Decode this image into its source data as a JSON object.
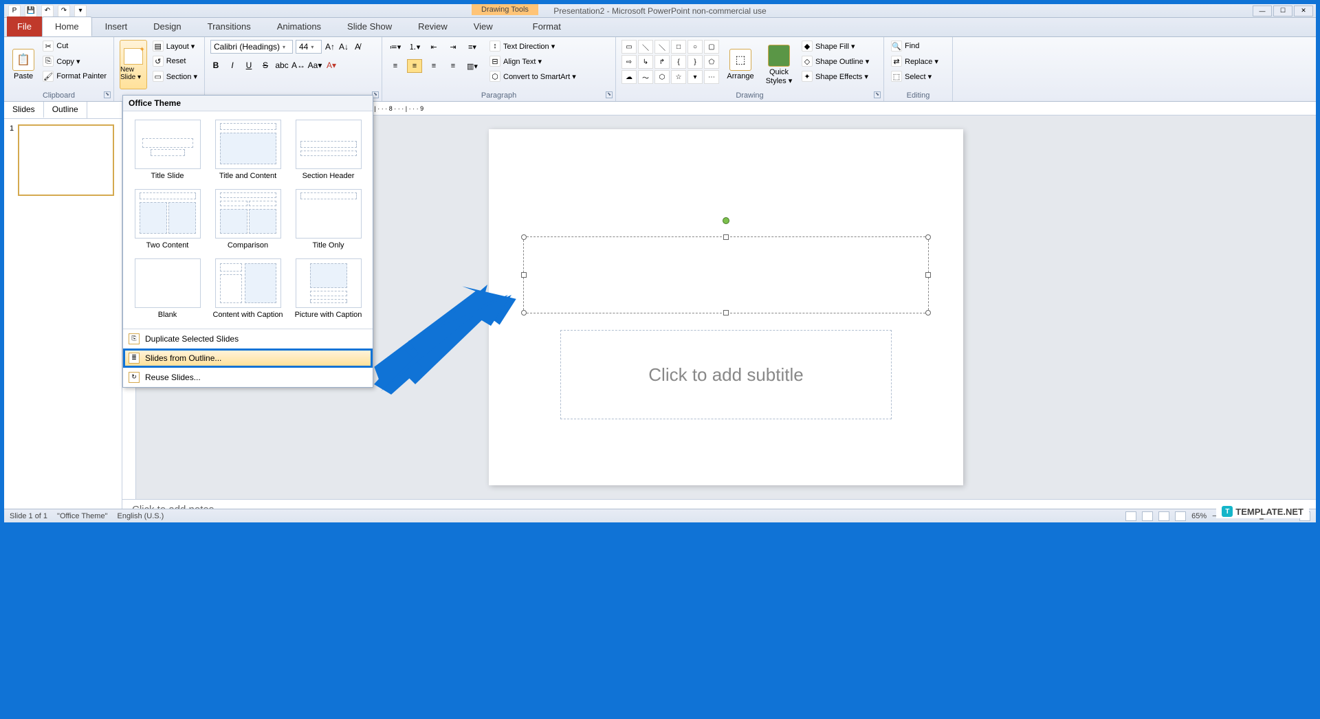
{
  "app": {
    "title": "Presentation2 - Microsoft PowerPoint non-commercial use",
    "context_tab": "Drawing Tools"
  },
  "tabs": {
    "file": "File",
    "home": "Home",
    "insert": "Insert",
    "design": "Design",
    "transitions": "Transitions",
    "animations": "Animations",
    "slideshow": "Slide Show",
    "review": "Review",
    "view": "View",
    "format": "Format"
  },
  "ribbon": {
    "clipboard": {
      "label": "Clipboard",
      "paste": "Paste",
      "cut": "Cut",
      "copy": "Copy ▾",
      "format_painter": "Format Painter"
    },
    "slides": {
      "new_slide": "New Slide ▾",
      "layout": "Layout ▾",
      "reset": "Reset",
      "section": "Section ▾"
    },
    "font": {
      "name": "Calibri (Headings)",
      "size": "44"
    },
    "paragraph": {
      "label": "Paragraph",
      "text_direction": "Text Direction ▾",
      "align_text": "Align Text ▾",
      "convert_smartart": "Convert to SmartArt ▾"
    },
    "drawing": {
      "label": "Drawing",
      "arrange": "Arrange",
      "quick_styles": "Quick Styles ▾",
      "shape_fill": "Shape Fill ▾",
      "shape_outline": "Shape Outline ▾",
      "shape_effects": "Shape Effects ▾"
    },
    "editing": {
      "label": "Editing",
      "find": "Find",
      "replace": "Replace ▾",
      "select": "Select ▾"
    }
  },
  "layout_dropdown": {
    "header": "Office Theme",
    "layouts": [
      "Title Slide",
      "Title and Content",
      "Section Header",
      "Two Content",
      "Comparison",
      "Title Only",
      "Blank",
      "Content with Caption",
      "Picture with Caption"
    ],
    "options": {
      "duplicate": "Duplicate Selected Slides",
      "from_outline": "Slides from Outline...",
      "reuse": "Reuse Slides..."
    }
  },
  "side_panel": {
    "tab_slides": "Slides",
    "tab_outline": "Outline",
    "slide_num": "1"
  },
  "canvas": {
    "subtitle_placeholder": "Click to add subtitle"
  },
  "notes": {
    "placeholder": "Click to add notes"
  },
  "statusbar": {
    "slide_info": "Slide 1 of 1",
    "theme": "\"Office Theme\"",
    "language": "English (U.S.)",
    "zoom": "65%"
  },
  "watermark": "TEMPLATE.NET"
}
